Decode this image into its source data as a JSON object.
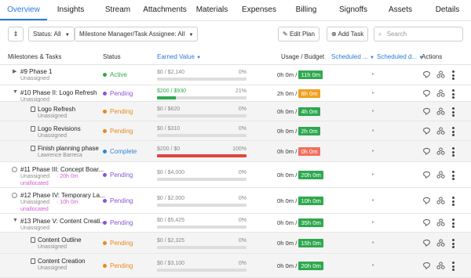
{
  "tabs": [
    "Overview",
    "Insights",
    "Stream",
    "Attachments",
    "Materials",
    "Expenses",
    "Billing",
    "Signoffs",
    "Assets",
    "Details"
  ],
  "toolbar": {
    "status_filter": "Status: All",
    "assignee_filter": "Milestone Manager/Task Assignee: All",
    "edit_plan": "Edit Plan",
    "add_task": "Add Task",
    "search_placeholder": "Search"
  },
  "columns": {
    "name": "Milestones & Tasks",
    "status": "Status",
    "earned_value": "Earned Value",
    "usage": "Usage / Budget",
    "sched1": "Scheduled ...",
    "sched2": "Scheduled d...",
    "actions": "Actions"
  },
  "colors": {
    "active": "#2fa84f",
    "pending_purple": "#8a55d6",
    "pending_orange": "#e8891b",
    "complete": "#2a86d8",
    "green": "#2fa84f",
    "orange": "#f0a020",
    "red": "#f07060",
    "redbar": "#e0463a",
    "accent": "#2a7ad8"
  },
  "rows": [
    {
      "name": "#9 Phase 1",
      "sub": "Unassigned",
      "sub2": "",
      "status": "Active",
      "status_color": "active",
      "ev": "$0 / $2,140",
      "pct": "0%",
      "usage": "0h 0m /",
      "budget": "11h 0m",
      "pill": "green",
      "fill": 0,
      "kind": "milestone-collapsed"
    },
    {
      "name": "#10 Phase II: Logo Refresh",
      "sub": "Unassigned",
      "sub2": "",
      "status": "Pending",
      "status_color": "pending_purple",
      "ev": "$200 / $930",
      "pct": "21%",
      "usage": "2h 0m /",
      "budget": "8h 0m",
      "pill": "orange",
      "fill": 0.21,
      "kind": "milestone-expanded",
      "evgreen": true
    },
    {
      "name": "Logo Refresh",
      "sub": "Unassigned",
      "sub2": "",
      "status": "Pending",
      "status_color": "pending_orange",
      "ev": "$0 / $620",
      "pct": "0%",
      "usage": "0h 0m /",
      "budget": "4h 0m",
      "pill": "green",
      "fill": 0,
      "kind": "task"
    },
    {
      "name": "Logo Revisions",
      "sub": "Unassigned",
      "sub2": "",
      "status": "Pending",
      "status_color": "pending_orange",
      "ev": "$0 / $310",
      "pct": "0%",
      "usage": "0h 0m /",
      "budget": "2h 0m",
      "pill": "green",
      "fill": 0,
      "kind": "task"
    },
    {
      "name": "Finish planning phase",
      "sub": "Lawrence Barreca",
      "sub2": "",
      "status": "Complete",
      "status_color": "complete",
      "ev": "$200 / $0",
      "pct": "100%",
      "usage": "0h 0m /",
      "budget": "0h 0m",
      "pill": "red",
      "fill": 1,
      "kind": "task",
      "redbar": true
    },
    {
      "name": "#11 Phase III: Concept Boar...",
      "sub": "Unassigned",
      "sub2": "· 20h 0m",
      "sub3": "unallocated",
      "status": "Pending",
      "status_color": "pending_purple",
      "ev": "$0 / $4,000",
      "pct": "0%",
      "usage": "0h 0m /",
      "budget": "20h 0m",
      "pill": "green",
      "fill": 0,
      "kind": "milestone-circle"
    },
    {
      "name": "#12 Phase IV: Temporary La...",
      "sub": "Unassigned",
      "sub2": "· 10h 0m",
      "sub3": "unallocated",
      "status": "Pending",
      "status_color": "pending_purple",
      "ev": "$0 / $2,000",
      "pct": "0%",
      "usage": "0h 0m /",
      "budget": "10h 0m",
      "pill": "green",
      "fill": 0,
      "kind": "milestone-circle"
    },
    {
      "name": "#13 Phase V: Content Creati...",
      "sub": "Unassigned",
      "sub2": "",
      "status": "Pending",
      "status_color": "pending_purple",
      "ev": "$0 / $5,425",
      "pct": "0%",
      "usage": "0h 0m /",
      "budget": "35h 0m",
      "pill": "green",
      "fill": 0,
      "kind": "milestone-expanded"
    },
    {
      "name": "Content Outline",
      "sub": "Unassigned",
      "sub2": "",
      "status": "Pending",
      "status_color": "pending_orange",
      "ev": "$0 / $2,325",
      "pct": "0%",
      "usage": "0h 0m /",
      "budget": "15h 0m",
      "pill": "green",
      "fill": 0,
      "kind": "task"
    },
    {
      "name": "Content Creation",
      "sub": "Unassigned",
      "sub2": "",
      "status": "Pending",
      "status_color": "pending_orange",
      "ev": "$0 / $3,100",
      "pct": "0%",
      "usage": "0h 0m /",
      "budget": "20h 0m",
      "pill": "green",
      "fill": 0,
      "kind": "task"
    }
  ]
}
